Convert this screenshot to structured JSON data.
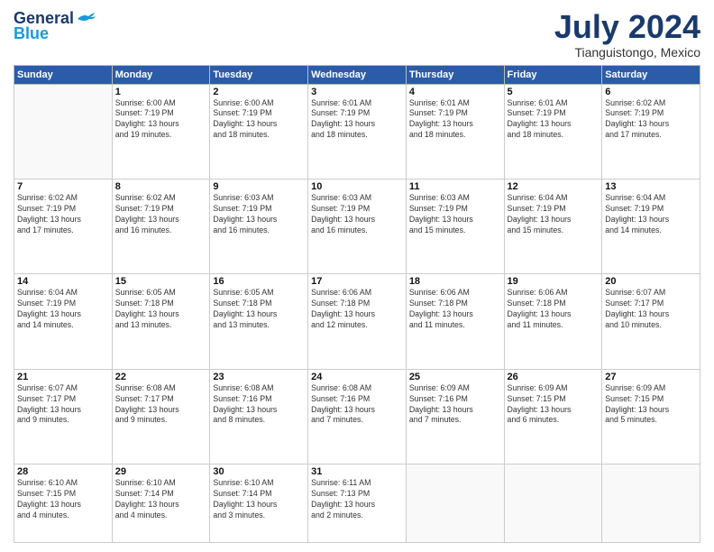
{
  "logo": {
    "line1": "General",
    "line2": "Blue"
  },
  "title": "July 2024",
  "location": "Tianguistongo, Mexico",
  "days_of_week": [
    "Sunday",
    "Monday",
    "Tuesday",
    "Wednesday",
    "Thursday",
    "Friday",
    "Saturday"
  ],
  "weeks": [
    [
      {
        "day": "",
        "info": ""
      },
      {
        "day": "1",
        "info": "Sunrise: 6:00 AM\nSunset: 7:19 PM\nDaylight: 13 hours\nand 19 minutes."
      },
      {
        "day": "2",
        "info": "Sunrise: 6:00 AM\nSunset: 7:19 PM\nDaylight: 13 hours\nand 18 minutes."
      },
      {
        "day": "3",
        "info": "Sunrise: 6:01 AM\nSunset: 7:19 PM\nDaylight: 13 hours\nand 18 minutes."
      },
      {
        "day": "4",
        "info": "Sunrise: 6:01 AM\nSunset: 7:19 PM\nDaylight: 13 hours\nand 18 minutes."
      },
      {
        "day": "5",
        "info": "Sunrise: 6:01 AM\nSunset: 7:19 PM\nDaylight: 13 hours\nand 18 minutes."
      },
      {
        "day": "6",
        "info": "Sunrise: 6:02 AM\nSunset: 7:19 PM\nDaylight: 13 hours\nand 17 minutes."
      }
    ],
    [
      {
        "day": "7",
        "info": "Sunrise: 6:02 AM\nSunset: 7:19 PM\nDaylight: 13 hours\nand 17 minutes."
      },
      {
        "day": "8",
        "info": "Sunrise: 6:02 AM\nSunset: 7:19 PM\nDaylight: 13 hours\nand 16 minutes."
      },
      {
        "day": "9",
        "info": "Sunrise: 6:03 AM\nSunset: 7:19 PM\nDaylight: 13 hours\nand 16 minutes."
      },
      {
        "day": "10",
        "info": "Sunrise: 6:03 AM\nSunset: 7:19 PM\nDaylight: 13 hours\nand 16 minutes."
      },
      {
        "day": "11",
        "info": "Sunrise: 6:03 AM\nSunset: 7:19 PM\nDaylight: 13 hours\nand 15 minutes."
      },
      {
        "day": "12",
        "info": "Sunrise: 6:04 AM\nSunset: 7:19 PM\nDaylight: 13 hours\nand 15 minutes."
      },
      {
        "day": "13",
        "info": "Sunrise: 6:04 AM\nSunset: 7:19 PM\nDaylight: 13 hours\nand 14 minutes."
      }
    ],
    [
      {
        "day": "14",
        "info": "Sunrise: 6:04 AM\nSunset: 7:19 PM\nDaylight: 13 hours\nand 14 minutes."
      },
      {
        "day": "15",
        "info": "Sunrise: 6:05 AM\nSunset: 7:18 PM\nDaylight: 13 hours\nand 13 minutes."
      },
      {
        "day": "16",
        "info": "Sunrise: 6:05 AM\nSunset: 7:18 PM\nDaylight: 13 hours\nand 13 minutes."
      },
      {
        "day": "17",
        "info": "Sunrise: 6:06 AM\nSunset: 7:18 PM\nDaylight: 13 hours\nand 12 minutes."
      },
      {
        "day": "18",
        "info": "Sunrise: 6:06 AM\nSunset: 7:18 PM\nDaylight: 13 hours\nand 11 minutes."
      },
      {
        "day": "19",
        "info": "Sunrise: 6:06 AM\nSunset: 7:18 PM\nDaylight: 13 hours\nand 11 minutes."
      },
      {
        "day": "20",
        "info": "Sunrise: 6:07 AM\nSunset: 7:17 PM\nDaylight: 13 hours\nand 10 minutes."
      }
    ],
    [
      {
        "day": "21",
        "info": "Sunrise: 6:07 AM\nSunset: 7:17 PM\nDaylight: 13 hours\nand 9 minutes."
      },
      {
        "day": "22",
        "info": "Sunrise: 6:08 AM\nSunset: 7:17 PM\nDaylight: 13 hours\nand 9 minutes."
      },
      {
        "day": "23",
        "info": "Sunrise: 6:08 AM\nSunset: 7:16 PM\nDaylight: 13 hours\nand 8 minutes."
      },
      {
        "day": "24",
        "info": "Sunrise: 6:08 AM\nSunset: 7:16 PM\nDaylight: 13 hours\nand 7 minutes."
      },
      {
        "day": "25",
        "info": "Sunrise: 6:09 AM\nSunset: 7:16 PM\nDaylight: 13 hours\nand 7 minutes."
      },
      {
        "day": "26",
        "info": "Sunrise: 6:09 AM\nSunset: 7:15 PM\nDaylight: 13 hours\nand 6 minutes."
      },
      {
        "day": "27",
        "info": "Sunrise: 6:09 AM\nSunset: 7:15 PM\nDaylight: 13 hours\nand 5 minutes."
      }
    ],
    [
      {
        "day": "28",
        "info": "Sunrise: 6:10 AM\nSunset: 7:15 PM\nDaylight: 13 hours\nand 4 minutes."
      },
      {
        "day": "29",
        "info": "Sunrise: 6:10 AM\nSunset: 7:14 PM\nDaylight: 13 hours\nand 4 minutes."
      },
      {
        "day": "30",
        "info": "Sunrise: 6:10 AM\nSunset: 7:14 PM\nDaylight: 13 hours\nand 3 minutes."
      },
      {
        "day": "31",
        "info": "Sunrise: 6:11 AM\nSunset: 7:13 PM\nDaylight: 13 hours\nand 2 minutes."
      },
      {
        "day": "",
        "info": ""
      },
      {
        "day": "",
        "info": ""
      },
      {
        "day": "",
        "info": ""
      }
    ]
  ]
}
